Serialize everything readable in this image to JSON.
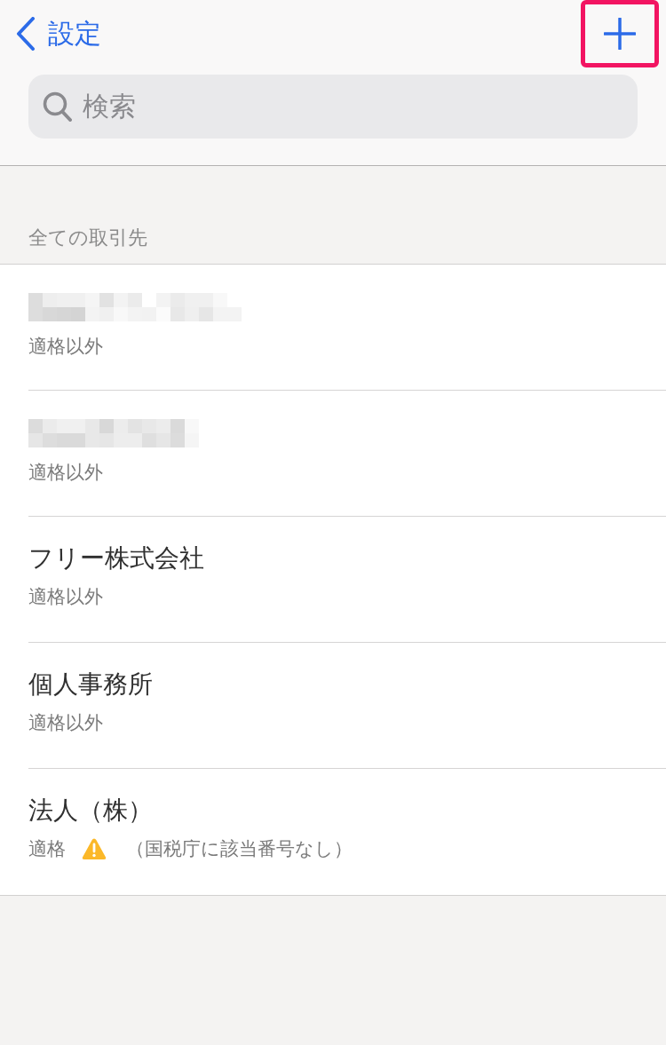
{
  "nav": {
    "back_label": "設定",
    "add_button": {
      "highlighted": true
    }
  },
  "search": {
    "placeholder": "検索"
  },
  "section": {
    "title": "全ての取引先"
  },
  "partners": [
    {
      "kind": "redacted",
      "status": "適格以外",
      "warning": false
    },
    {
      "kind": "redacted",
      "status": "適格以外",
      "warning": false
    },
    {
      "kind": "named",
      "name": "フリー株式会社",
      "status": "適格以外",
      "warning": false
    },
    {
      "kind": "named",
      "name": "個人事務所",
      "status": "適格以外",
      "warning": false
    },
    {
      "kind": "named",
      "name": "法人（株）",
      "status": "適格",
      "warning": true,
      "note": "（国税庁に該当番号なし）"
    }
  ]
}
